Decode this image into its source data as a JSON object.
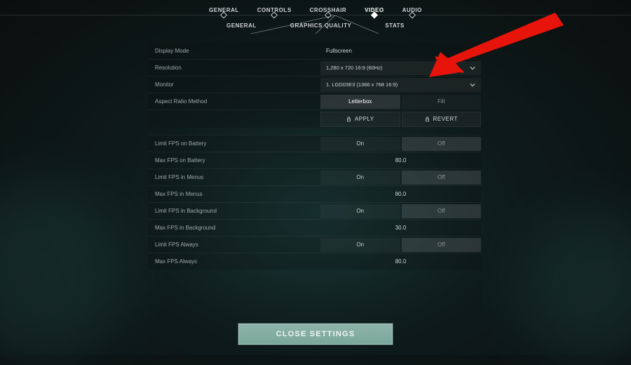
{
  "top_tabs": {
    "general": "GENERAL",
    "controls": "CONTROLS",
    "crosshair": "CROSSHAIR",
    "video": "VIDEO",
    "audio": "AUDIO"
  },
  "sub_tabs": {
    "general": "GENERAL",
    "graphics": "GRAPHICS QUALITY",
    "stats": "STATS"
  },
  "rows": {
    "display_mode": {
      "label": "Display Mode",
      "value": "Fullscreen"
    },
    "resolution": {
      "label": "Resolution",
      "value": "1,280 x 720 16:9 (60Hz)"
    },
    "monitor": {
      "label": "Monitor",
      "value": "1. LGD03E3 (1366 x  768 16:9)"
    },
    "aspect": {
      "label": "Aspect Ratio Method",
      "opt_a": "Letterbox",
      "opt_b": "Fill"
    },
    "apply": "APPLY",
    "revert": "REVERT",
    "limit_battery": {
      "label": "Limit FPS on Battery",
      "opt_a": "On",
      "opt_b": "Off"
    },
    "max_battery": {
      "label": "Max FPS on Battery",
      "value": "80.0"
    },
    "limit_menus": {
      "label": "Limit FPS in Menus",
      "opt_a": "On",
      "opt_b": "Off"
    },
    "max_menus": {
      "label": "Max FPS in Menus",
      "value": "80.0"
    },
    "limit_bg": {
      "label": "Limit FPS in Background",
      "opt_a": "On",
      "opt_b": "Off"
    },
    "max_bg": {
      "label": "Max FPS in Background",
      "value": "30.0"
    },
    "limit_always": {
      "label": "Limit FPS Always",
      "opt_a": "On",
      "opt_b": "Off"
    },
    "max_always": {
      "label": "Max FPS Always",
      "value": "80.0"
    }
  },
  "close": "CLOSE SETTINGS"
}
